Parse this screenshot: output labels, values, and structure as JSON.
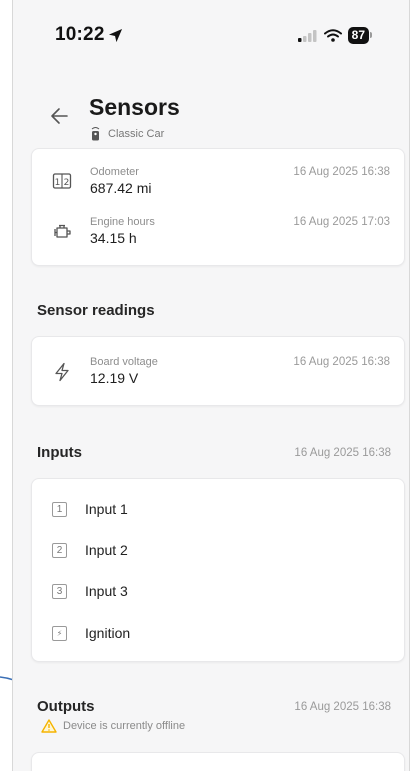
{
  "status_bar": {
    "time": "10:22",
    "battery": "87",
    "icons": [
      "location-arrow-icon",
      "cellular-signal-icon",
      "wifi-icon",
      "battery-icon"
    ]
  },
  "header": {
    "title": "Sensors",
    "device_name": "Classic Car",
    "icons": [
      "back-arrow-icon",
      "car-key-fob-icon"
    ]
  },
  "counters_card": {
    "rows": [
      {
        "label": "Odometer",
        "value": "687.42 mi",
        "time": "16 Aug 2025 16:38",
        "icon": "odometer-icon"
      },
      {
        "label": "Engine hours",
        "value": "34.15 h",
        "time": "16 Aug 2025 17:03",
        "icon": "engine-icon"
      }
    ]
  },
  "sensor_readings": {
    "title": "Sensor readings",
    "rows": [
      {
        "label": "Board voltage",
        "value": "12.19 V",
        "time": "16 Aug 2025 16:38",
        "icon": "lightning-icon"
      }
    ]
  },
  "inputs": {
    "title": "Inputs",
    "time": "16 Aug 2025 16:38",
    "items": [
      {
        "number": "1",
        "label": "Input 1"
      },
      {
        "number": "2",
        "label": "Input 2"
      },
      {
        "number": "3",
        "label": "Input 3"
      },
      {
        "number": "⚡",
        "label": "Ignition"
      }
    ]
  },
  "outputs": {
    "title": "Outputs",
    "time": "16 Aug 2025 16:38",
    "warning": "Device is currently offline"
  },
  "colors": {
    "background": "#f6f6f7",
    "card": "#ffffff",
    "warning": "#f5b400",
    "annotation_arrow": "#3b6fb5"
  }
}
